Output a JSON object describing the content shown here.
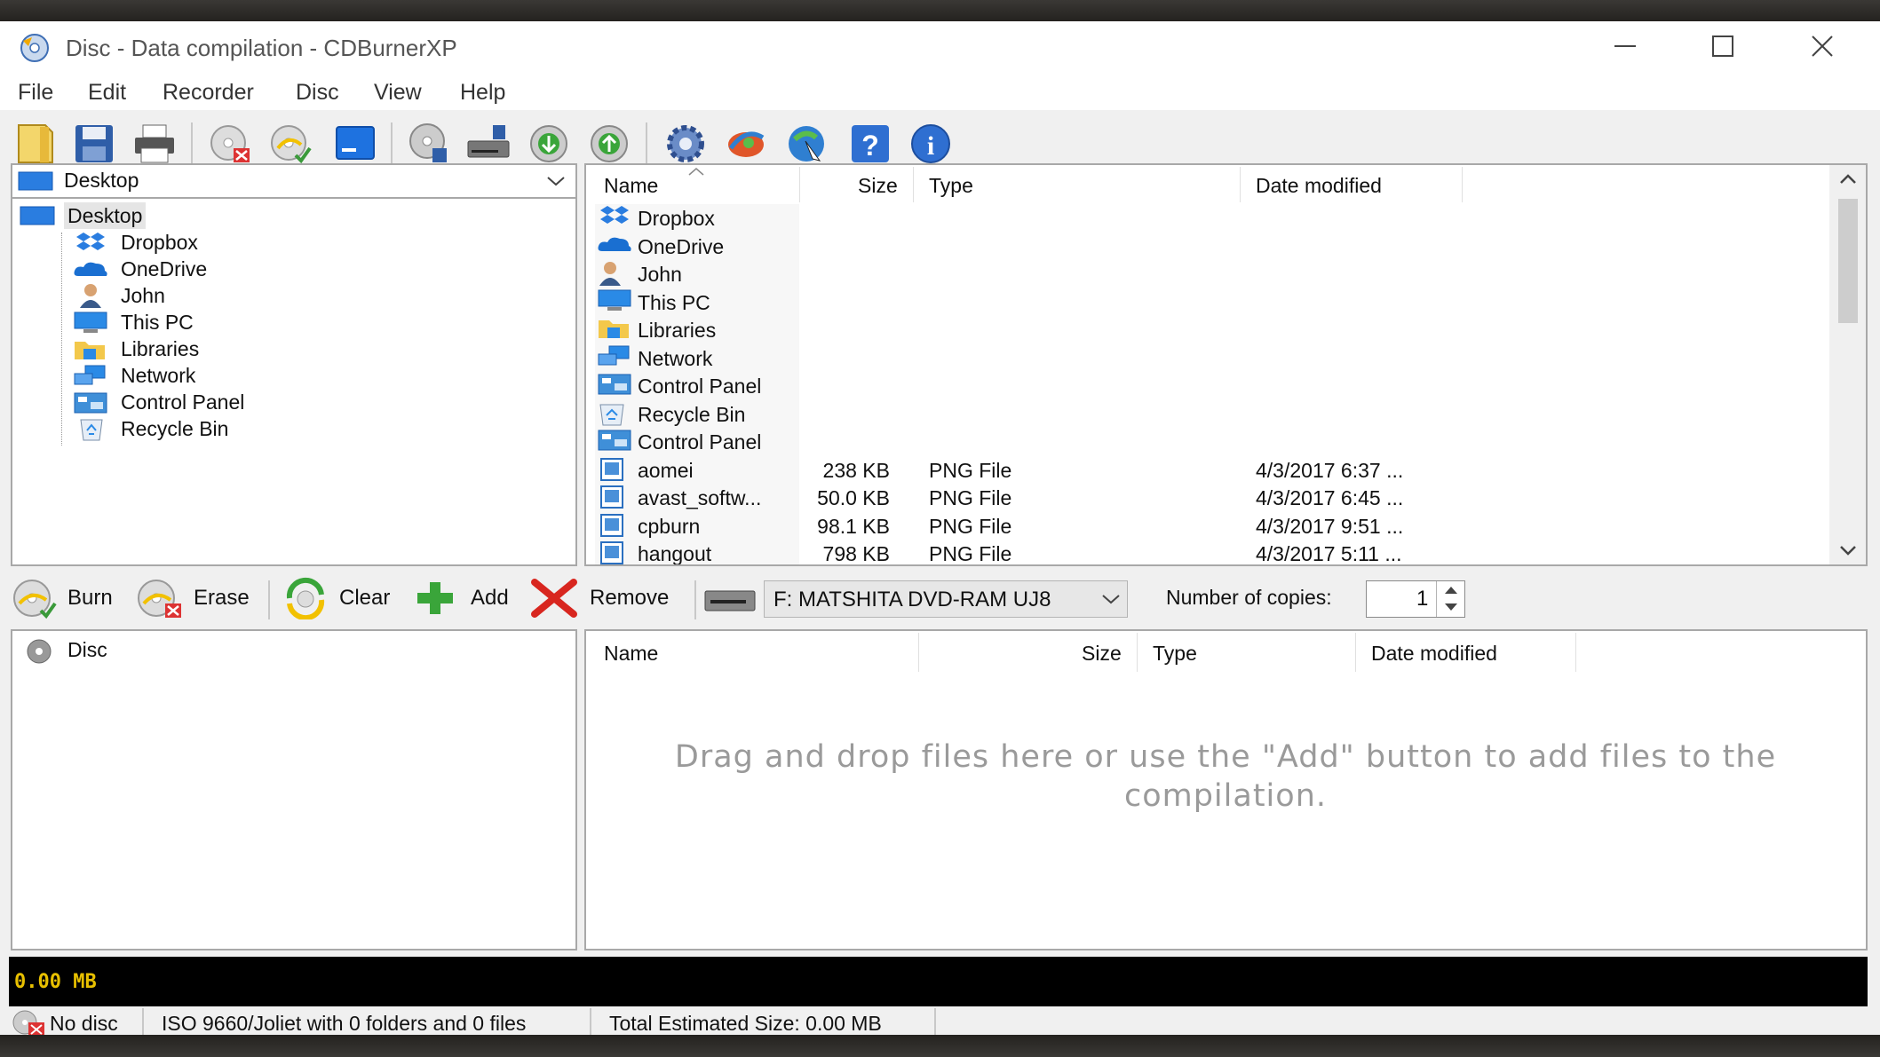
{
  "window": {
    "title": "Disc - Data compilation - CDBurnerXP"
  },
  "menu": [
    "File",
    "Edit",
    "Recorder",
    "Disc",
    "View",
    "Help"
  ],
  "toolbar_icons": [
    "new-icon",
    "save-icon",
    "print-icon",
    "erase-disc-icon",
    "burn-disc-icon",
    "window-icon",
    "disc-info-icon",
    "drive-icon",
    "disc-download-icon",
    "disc-upload-icon",
    "settings-icon",
    "website-icon",
    "update-icon",
    "help-icon",
    "about-icon"
  ],
  "folder_tree": {
    "selected_path": "Desktop",
    "root": "Desktop",
    "items": [
      "Dropbox",
      "OneDrive",
      "John",
      "This PC",
      "Libraries",
      "Network",
      "Control Panel",
      "Recycle Bin"
    ]
  },
  "file_list": {
    "columns": {
      "name": "Name",
      "size": "Size",
      "type": "Type",
      "date": "Date modified"
    },
    "rows": [
      {
        "name": "Dropbox",
        "size": "",
        "type": "",
        "date": "",
        "icon": "dropbox-icon"
      },
      {
        "name": "OneDrive",
        "size": "",
        "type": "",
        "date": "",
        "icon": "onedrive-icon"
      },
      {
        "name": "John",
        "size": "",
        "type": "",
        "date": "",
        "icon": "user-icon"
      },
      {
        "name": "This PC",
        "size": "",
        "type": "",
        "date": "",
        "icon": "pc-icon"
      },
      {
        "name": "Libraries",
        "size": "",
        "type": "",
        "date": "",
        "icon": "libraries-icon"
      },
      {
        "name": "Network",
        "size": "",
        "type": "",
        "date": "",
        "icon": "network-icon"
      },
      {
        "name": "Control Panel",
        "size": "",
        "type": "",
        "date": "",
        "icon": "control-panel-icon"
      },
      {
        "name": "Recycle Bin",
        "size": "",
        "type": "",
        "date": "",
        "icon": "recycle-bin-icon"
      },
      {
        "name": "Control Panel",
        "size": "",
        "type": "",
        "date": "",
        "icon": "control-panel-icon"
      },
      {
        "name": "aomei",
        "size": "238 KB",
        "type": "PNG File",
        "date": "4/3/2017 6:37 ...",
        "icon": "png-file-icon"
      },
      {
        "name": "avast_softw...",
        "size": "50.0 KB",
        "type": "PNG File",
        "date": "4/3/2017 6:45 ...",
        "icon": "png-file-icon"
      },
      {
        "name": "cpburn",
        "size": "98.1 KB",
        "type": "PNG File",
        "date": "4/3/2017 9:51 ...",
        "icon": "png-file-icon"
      },
      {
        "name": "hangout",
        "size": "798 KB",
        "type": "PNG File",
        "date": "4/3/2017 5:11 ...",
        "icon": "png-file-icon"
      }
    ]
  },
  "actions": {
    "burn": "Burn",
    "erase": "Erase",
    "clear": "Clear",
    "add": "Add",
    "remove": "Remove",
    "drive": "F: MATSHITA DVD-RAM UJ8",
    "copies_label": "Number of copies:",
    "copies_value": "1"
  },
  "compilation_tree": {
    "root": "Disc"
  },
  "compilation_list": {
    "columns": {
      "name": "Name",
      "size": "Size",
      "type": "Type",
      "date": "Date modified"
    },
    "empty_message": "Drag and drop files here or use the \"Add\" button to add files to the compilation."
  },
  "size_bar": {
    "label": "0.00 MB",
    "fill_fraction": 0.0,
    "text_color": "#e8c000"
  },
  "status": {
    "disc": "No disc",
    "filesystem": "ISO 9660/Joliet with 0 folders and 0 files",
    "total": "Total Estimated Size: 0.00 MB"
  }
}
